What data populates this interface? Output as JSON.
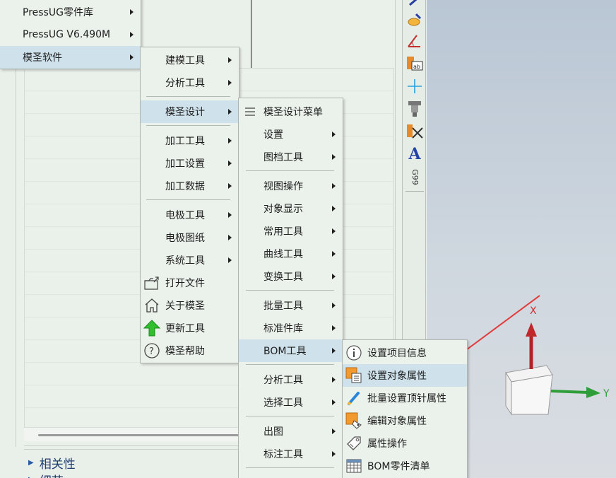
{
  "nav_panel": {
    "sections": [
      "相关性",
      "细节"
    ]
  },
  "menu_main": {
    "items": [
      {
        "label": "PressUG零件库",
        "submenu": true
      },
      {
        "label": "PressUG  V6.490M",
        "submenu": true
      },
      {
        "label": "模圣软件",
        "submenu": true,
        "selected": true
      }
    ]
  },
  "menu_mosheng": {
    "items": [
      {
        "label": "建模工具",
        "submenu": true
      },
      {
        "label": "分析工具",
        "submenu": true
      },
      {
        "label": "模圣设计",
        "submenu": true,
        "selected": true
      },
      {
        "label": "加工工具",
        "submenu": true
      },
      {
        "label": "加工设置",
        "submenu": true
      },
      {
        "label": "加工数据",
        "submenu": true
      },
      {
        "label": "电极工具",
        "submenu": true
      },
      {
        "label": "电极图纸",
        "submenu": true
      },
      {
        "label": "系统工具",
        "submenu": true
      },
      {
        "label": "打开文件",
        "icon": "open-file-icon"
      },
      {
        "label": "关于模圣",
        "icon": "home-icon"
      },
      {
        "label": "更新工具",
        "icon": "green-up-arrow-icon"
      },
      {
        "label": "模圣帮助",
        "icon": "help-icon"
      }
    ]
  },
  "menu_design": {
    "items": [
      {
        "label": "模圣设计菜单",
        "icon": "menu-lines-icon"
      },
      {
        "label": "设置",
        "submenu": true
      },
      {
        "label": "图档工具",
        "submenu": true
      },
      {
        "label": "视图操作",
        "submenu": true
      },
      {
        "label": "对象显示",
        "submenu": true
      },
      {
        "label": "常用工具",
        "submenu": true
      },
      {
        "label": "曲线工具",
        "submenu": true
      },
      {
        "label": "变换工具",
        "submenu": true
      },
      {
        "label": "批量工具",
        "submenu": true
      },
      {
        "label": "标准件库",
        "submenu": true
      },
      {
        "label": "BOM工具",
        "submenu": true,
        "selected": true
      },
      {
        "label": "分析工具",
        "submenu": true
      },
      {
        "label": "选择工具",
        "submenu": true
      },
      {
        "label": "出图",
        "submenu": true
      },
      {
        "label": "标注工具",
        "submenu": true
      }
    ]
  },
  "menu_bom": {
    "items": [
      {
        "label": "设置项目信息",
        "icon": "info-icon"
      },
      {
        "label": "设置对象属性",
        "icon": "object-properties-icon",
        "selected": true
      },
      {
        "label": "批量设置顶针属性",
        "icon": "ejector-pin-icon"
      },
      {
        "label": "编辑对象属性",
        "icon": "edit-properties-icon"
      },
      {
        "label": "属性操作",
        "icon": "tag-icon"
      },
      {
        "label": "BOM零件清单",
        "icon": "table-icon"
      }
    ]
  },
  "toolbar": {
    "text_tool": "A",
    "g99_label": "G99"
  },
  "viewport": {
    "axis_x": "X",
    "axis_y": "Y"
  },
  "colors": {
    "menu_bg": "#ebf1eb",
    "selected_bg": "#cfe2ec",
    "annotation_arrow": "#e23b3b",
    "axis_x": "#c0282c",
    "axis_y": "#2f9e3a"
  }
}
